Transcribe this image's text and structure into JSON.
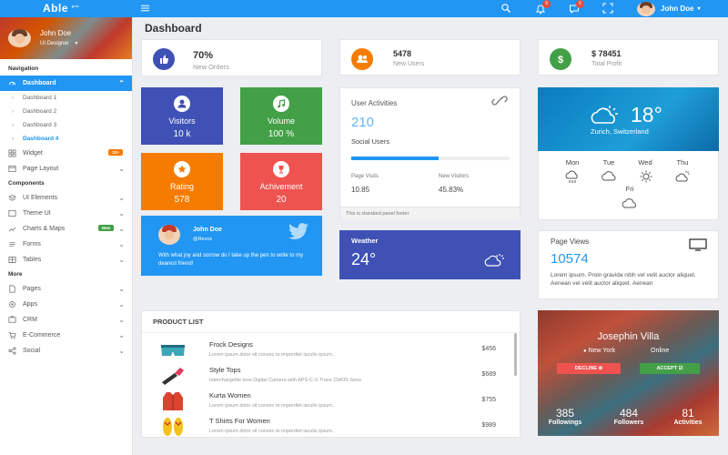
{
  "brand": {
    "name": "Able",
    "sup": "pro"
  },
  "topbar": {
    "notif_count": "9",
    "msg_count": "5",
    "user_name": "John Doe"
  },
  "sidebar": {
    "user_name": "John Doe",
    "user_role": "UI Designer",
    "sections": [
      "Navigation",
      "Components",
      "More"
    ],
    "dashboard": "Dashboard",
    "subs": [
      "Dashboard 1",
      "Dashboard 2",
      "Dashboard 3",
      "Dashboard 4"
    ],
    "widget": "Widget",
    "widget_badge": "23+",
    "page_layout": "Page Layout",
    "ui_elements": "UI Elements",
    "theme_ui": "Theme UI",
    "charts_maps": "Charts & Maps",
    "charts_badge": "New",
    "forms": "Forms",
    "tables": "Tables",
    "pages": "Pages",
    "apps": "Apps",
    "crm": "CRM",
    "ecommerce": "E-Commerce",
    "social": "Social"
  },
  "page_title": "Dashboard",
  "stats": [
    {
      "value": "70%",
      "label": "New Orders",
      "color": "#3f51b5"
    },
    {
      "value": "5478",
      "label": "New Users",
      "color": "#f57c00"
    },
    {
      "value": "$ 78451",
      "label": "Total Profit",
      "color": "#43a047"
    }
  ],
  "tiles": [
    {
      "title": "Visitors",
      "value": "10 k",
      "color": "#3f51b5"
    },
    {
      "title": "Volume",
      "value": "100 %",
      "color": "#43a047"
    },
    {
      "title": "Rating",
      "value": "578",
      "color": "#f57c00"
    },
    {
      "title": "Achivement",
      "value": "20",
      "color": "#ef5350"
    }
  ],
  "activities": {
    "title": "User Activities",
    "value": "210",
    "social": "Social Users",
    "progress": 0.55,
    "visits_label": "Page Visits",
    "visits_value": "10.85",
    "newv_label": "New Visitors",
    "newv_value": "45.83%",
    "footer": "This is standard panel footer"
  },
  "weather_main": {
    "temp": "18°",
    "location": "Zurich, Switzerland"
  },
  "days": [
    "Mon",
    "Tue",
    "Wed",
    "Thu",
    "Fri"
  ],
  "tweet": {
    "name": "John Doe",
    "handle": "@Revox",
    "text": "With what joy and sorrow do I take up the pen to write to my dearest friend!"
  },
  "weather_small": {
    "label": "Weather",
    "temp": "24°"
  },
  "page_views": {
    "title": "Page Views",
    "value": "10574",
    "text": "Lorem ipsum. Proin gravida nibh vel velit auctor aliquet. Aenean vel velit auctor aliquet. Aenean"
  },
  "product_list": {
    "title": "PRODUCT LIST",
    "items": [
      {
        "name": "Frock Designs",
        "desc": "Lorem ipsum dolor sit consec te imperdiet iaculis ipsum..",
        "price": "$456"
      },
      {
        "name": "Style Tops",
        "desc": "Interchargeble lens Digital Camera with APS-C-X Trans CMOS Sens",
        "price": "$689"
      },
      {
        "name": "Kurta Women",
        "desc": "Lorem ipsum dolor sit consec te imperdiet iaculis ipsum..",
        "price": "$755"
      },
      {
        "name": "T Shirts For Women",
        "desc": "Lorem ipsum dolor sit consec te imperdiet iaculis ipsum..",
        "price": "$989"
      }
    ]
  },
  "profile": {
    "name": "Josephin Villa",
    "city": "New York",
    "status": "Online",
    "decline": "DECLINE",
    "accept": "ACCEPT",
    "stats": [
      {
        "value": "385",
        "label": "Followings"
      },
      {
        "value": "484",
        "label": "Followers"
      },
      {
        "value": "81",
        "label": "Activities"
      }
    ]
  }
}
